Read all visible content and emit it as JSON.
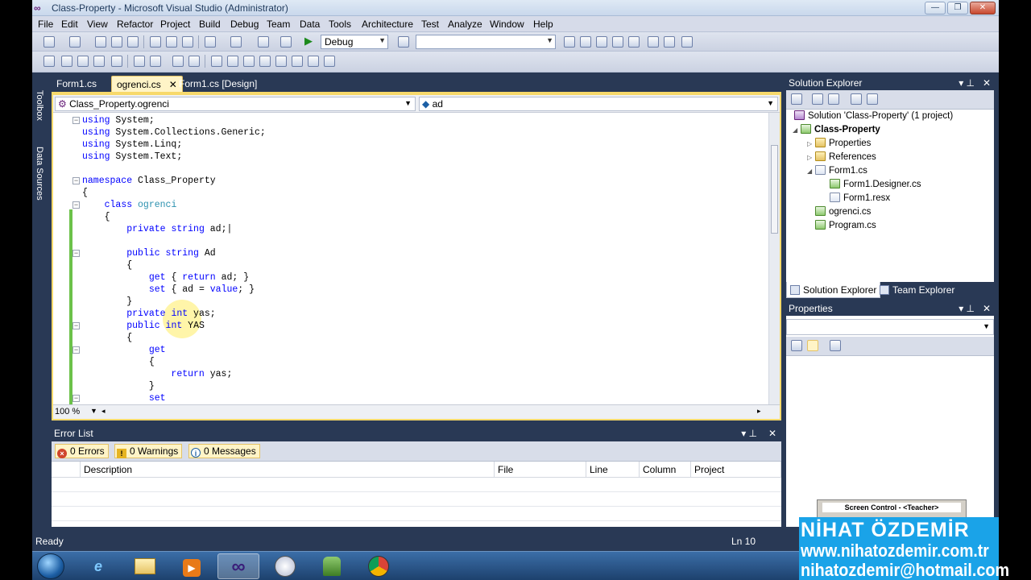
{
  "window": {
    "title": "Class-Property - Microsoft Visual Studio (Administrator)",
    "min_glyph": "—",
    "max_glyph": "❐",
    "close_glyph": "✕"
  },
  "menu": [
    "File",
    "Edit",
    "View",
    "Refactor",
    "Project",
    "Build",
    "Debug",
    "Team",
    "Data",
    "Tools",
    "Architecture",
    "Test",
    "Analyze",
    "Window",
    "Help"
  ],
  "toolbar": {
    "config_value": "Debug",
    "platform_value": "",
    "play_glyph": "▶"
  },
  "sidebar": {
    "toolbox_label": "Toolbox",
    "datasources_label": "Data Sources"
  },
  "tabs": [
    {
      "label": "Form1.cs"
    },
    {
      "label": "ogrenci.cs",
      "close": "✕"
    },
    {
      "label": "Form1.cs [Design]"
    }
  ],
  "editor": {
    "class_combo": "Class_Property.ogrenci",
    "member_combo": "ad",
    "zoom": "100 %",
    "lines": [
      "using System;",
      "using System.Collections.Generic;",
      "using System.Linq;",
      "using System.Text;",
      "",
      "namespace Class_Property",
      "{",
      "    class ogrenci",
      "    {",
      "        private string ad;",
      "",
      "        public string Ad",
      "        {",
      "            get { return ad; }",
      "            set { ad = value; }",
      "        }",
      "        private int yas;",
      "        public int YAS",
      "        {",
      "            get",
      "            {",
      "                return yas;",
      "            }",
      "            set",
      "            {"
    ]
  },
  "error_list": {
    "title": "Error List",
    "errors": "0 Errors",
    "warnings": "0 Warnings",
    "messages": "0 Messages",
    "columns": [
      "Description",
      "File",
      "Line",
      "Column",
      "Project"
    ]
  },
  "solution_explorer": {
    "title": "Solution Explorer",
    "items": [
      {
        "label": "Solution 'Class-Property' (1 project)",
        "icon": "solution-icon"
      },
      {
        "label": "Class-Property",
        "icon": "project-icon"
      },
      {
        "label": "Properties",
        "icon": "properties-icon"
      },
      {
        "label": "References",
        "icon": "references-icon"
      },
      {
        "label": "Form1.cs",
        "icon": "form-icon"
      },
      {
        "label": "Form1.Designer.cs",
        "icon": "cs-file-icon"
      },
      {
        "label": "Form1.resx",
        "icon": "resx-file-icon"
      },
      {
        "label": "ogrenci.cs",
        "icon": "cs-file-icon"
      },
      {
        "label": "Program.cs",
        "icon": "cs-file-icon"
      }
    ],
    "tab_solution": "Solution Explorer",
    "tab_team": "Team Explorer"
  },
  "properties": {
    "title": "Properties",
    "screen_control_title": "Screen Control - <Teacher>"
  },
  "status": {
    "left": "Ready",
    "line": "Ln 10"
  },
  "watermark": {
    "name": "NİHAT ÖZDEMİR",
    "site": "www.nihatozdemir.com.tr",
    "email": "nihatozdemir@hotmail.com"
  },
  "colors": {
    "chrome": "#293955",
    "active_tab": "#fff4c7",
    "keyword": "#0000ff",
    "type": "#2b91af",
    "watermark_bg": "#1aa3e8"
  }
}
